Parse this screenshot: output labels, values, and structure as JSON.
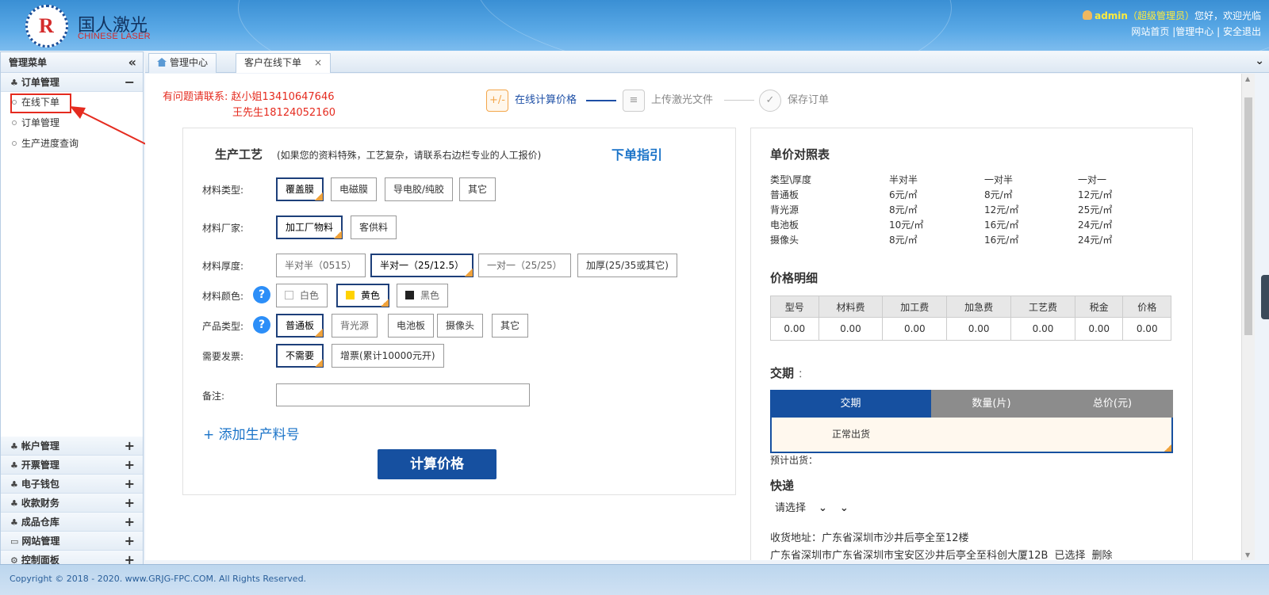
{
  "brand": {
    "name_cn": "国人激光",
    "name_en": "CHINESE LASER",
    "logo_letter": "R"
  },
  "user": {
    "name": "admin",
    "role": "（超级管理员）",
    "greeting": "您好，欢迎光临",
    "links": [
      "网站首页",
      "|管理中心",
      "|",
      "安全退出"
    ]
  },
  "sidebar": {
    "title": "管理菜单",
    "collapse_icon": "«",
    "order_group": {
      "label": "订单管理",
      "toggle": "−"
    },
    "order_items": [
      "在线下单",
      "订单管理",
      "生产进度查询"
    ],
    "groups": [
      {
        "label": "帐户管理",
        "icon": "leaf-icon"
      },
      {
        "label": "开票管理",
        "icon": "leaf-icon"
      },
      {
        "label": "电子钱包",
        "icon": "leaf-icon"
      },
      {
        "label": "收款财务",
        "icon": "leaf-icon"
      },
      {
        "label": "成品仓库",
        "icon": "leaf-icon"
      },
      {
        "label": "网站管理",
        "icon": "monitor-icon"
      },
      {
        "label": "控制面板",
        "icon": "gear-icon"
      }
    ],
    "group_toggle": "+"
  },
  "tabs": [
    {
      "label": "管理中心"
    },
    {
      "label": "客户在线下单"
    }
  ],
  "tab_close": "×",
  "contact": {
    "line1": "有问题请联系: 赵小姐13410647646",
    "line2": "王先生18124052160"
  },
  "steps": [
    {
      "label": "在线计算价格",
      "icon": "+/-"
    },
    {
      "label": "上传激光文件",
      "icon": "≡"
    },
    {
      "label": "保存订单",
      "icon": "✓"
    }
  ],
  "form": {
    "title": "生产工艺",
    "note": "(如果您的资料特殊，工艺复杂，请联系右边栏专业的人工报价)",
    "guide": "下单指引",
    "material_type": {
      "label": "材料类型:",
      "options": [
        "覆盖膜",
        "电磁膜",
        "导电胶/纯胶",
        "其它"
      ],
      "selected": 0
    },
    "manufacturer": {
      "label": "材料厂家:",
      "options": [
        "加工厂物料",
        "客供料"
      ],
      "selected": 0
    },
    "thickness": {
      "label": "材料厚度:",
      "options": [
        "半对半（0515）",
        "半对一（25/12.5）",
        "一对一（25/25）",
        "加厚(25/35或其它)"
      ],
      "selected": 1
    },
    "color": {
      "label": "材料颜色:",
      "options": [
        "白色",
        "黄色",
        "黑色"
      ],
      "selected": 1,
      "swatches": [
        "#ffffff",
        "#ffd200",
        "#222222"
      ]
    },
    "product": {
      "label": "产品类型:",
      "options": [
        "普通板",
        "背光源",
        "电池板",
        "摄像头",
        "其它"
      ],
      "selected": 0
    },
    "invoice": {
      "label": "需要发票:",
      "options": [
        "不需要",
        "增票(累计10000元开)"
      ],
      "selected": 0
    },
    "remark": {
      "label": "备注:",
      "value": ""
    },
    "help": "?",
    "add_link": "+ 添加生产料号",
    "calc_button": "计算价格"
  },
  "price_table": {
    "title": "单价对照表",
    "header": [
      "类型\\厚度",
      "半对半",
      "一对半",
      "一对一"
    ],
    "rows": [
      [
        "普通板",
        "6元/㎡",
        "8元/㎡",
        "12元/㎡"
      ],
      [
        "背光源",
        "8元/㎡",
        "12元/㎡",
        "25元/㎡"
      ],
      [
        "电池板",
        "10元/㎡",
        "16元/㎡",
        "24元/㎡"
      ],
      [
        "摄像头",
        "8元/㎡",
        "16元/㎡",
        "24元/㎡"
      ]
    ]
  },
  "price_detail": {
    "title": "价格明细",
    "headers": [
      "型号",
      "材料费",
      "加工费",
      "加急费",
      "工艺费",
      "税金",
      "价格"
    ],
    "values": [
      "0.00",
      "0.00",
      "0.00",
      "0.00",
      "0.00",
      "0.00",
      "0.00"
    ]
  },
  "delivery": {
    "title": "交期",
    "colon": "：",
    "tabs": [
      "交期",
      "数量(片)",
      "总价(元)"
    ],
    "value": "正常出货",
    "estimate": "预计出货："
  },
  "express": {
    "title": "快递",
    "select": "请选择",
    "address_label": "收货地址：",
    "address_value": "广东省深圳市沙井后亭全至12楼",
    "address_full": "广东省深圳市广东省深圳市宝安区沙井后亭全至科创大厦12B",
    "selected_text": "已选择",
    "delete_text": "删除"
  },
  "footer": {
    "copyright": "Copyright © 2018 - 2020. www.GRJG-FPC.COM. All Rights Reserved."
  },
  "colors": {
    "accent": "#1650a0",
    "warning_red": "#e52b1f",
    "link_blue": "#1a73c8",
    "header_blue": "#3a8fd4"
  }
}
